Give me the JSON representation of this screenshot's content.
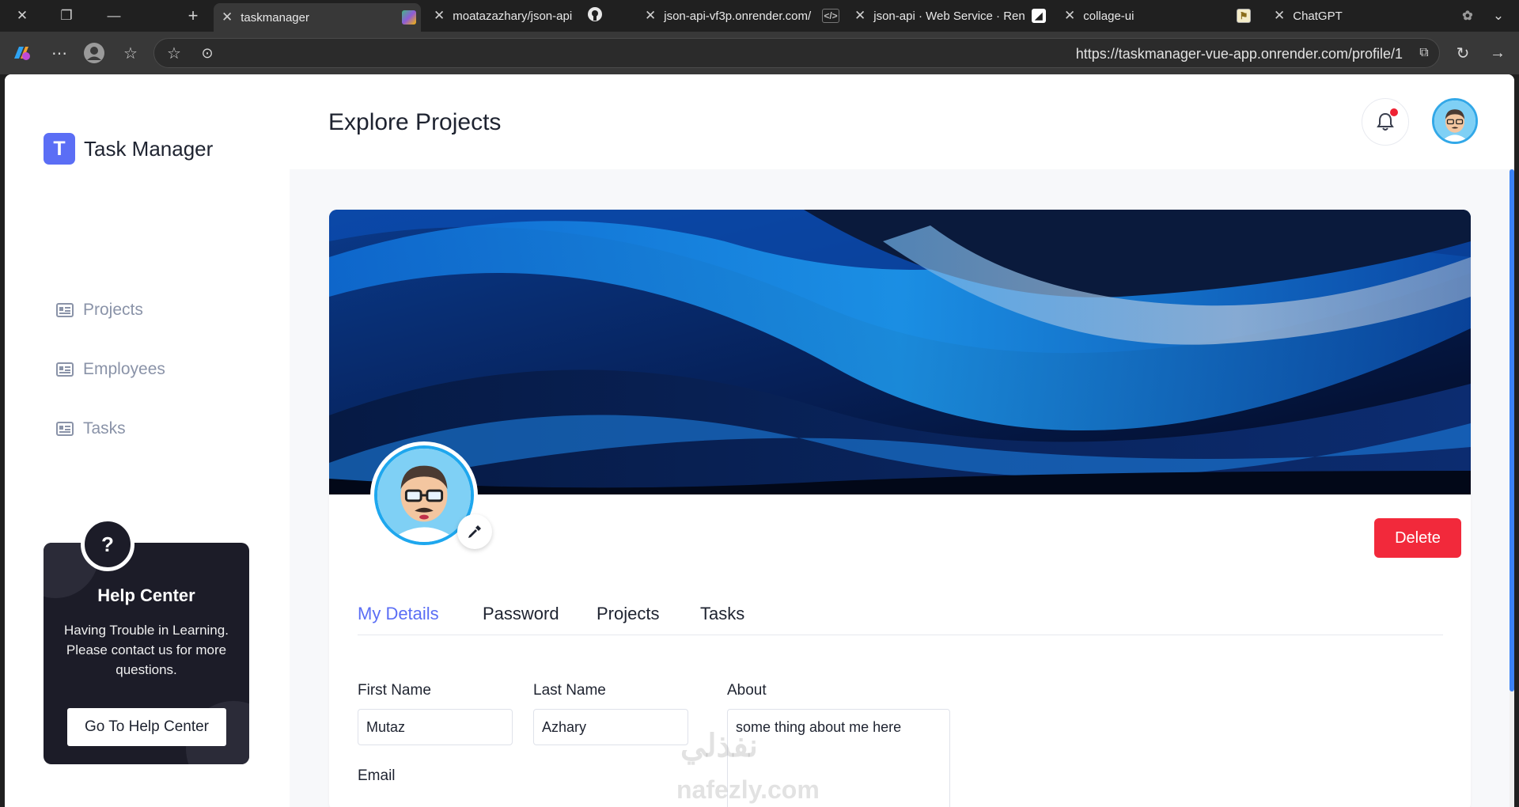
{
  "browser": {
    "tabs": [
      {
        "title": "taskmanager",
        "active": true
      },
      {
        "title": "moatazazhary/json-api",
        "active": false
      },
      {
        "title": "json-api-vf3p.onrender.com/",
        "active": false
      },
      {
        "title": "json-api · Web Service · Ren",
        "active": false
      },
      {
        "title": "collage-ui",
        "active": false
      },
      {
        "title": "ChatGPT",
        "active": false
      }
    ],
    "url": "https://taskmanager-vue-app.onrender.com/profile/1"
  },
  "sidebar": {
    "brand_initial": "T",
    "brand_name": "Task Manager",
    "items": [
      {
        "label": "Projects"
      },
      {
        "label": "Employees"
      },
      {
        "label": "Tasks"
      }
    ],
    "help": {
      "icon": "?",
      "title": "Help Center",
      "text": "Having Trouble in Learning. Please contact us for more questions.",
      "button": "Go To Help Center"
    }
  },
  "header": {
    "title": "Explore Projects"
  },
  "profile": {
    "delete_label": "Delete",
    "tabs": [
      {
        "label": "My Details",
        "active": true
      },
      {
        "label": "Password",
        "active": false
      },
      {
        "label": "Projects",
        "active": false
      },
      {
        "label": "Tasks",
        "active": false
      }
    ],
    "form": {
      "first_name_label": "First Name",
      "first_name": "Mutaz",
      "last_name_label": "Last Name",
      "last_name": "Azhary",
      "about_label": "About",
      "about": "some thing about me here",
      "email_label": "Email"
    }
  },
  "watermark": {
    "arabic": "نفذلي",
    "latin": "nafezly.com"
  },
  "colors": {
    "accent": "#5b6ef5",
    "danger": "#f2293b",
    "help_bg": "#1c1c28",
    "nav_text": "#8a93a8"
  }
}
